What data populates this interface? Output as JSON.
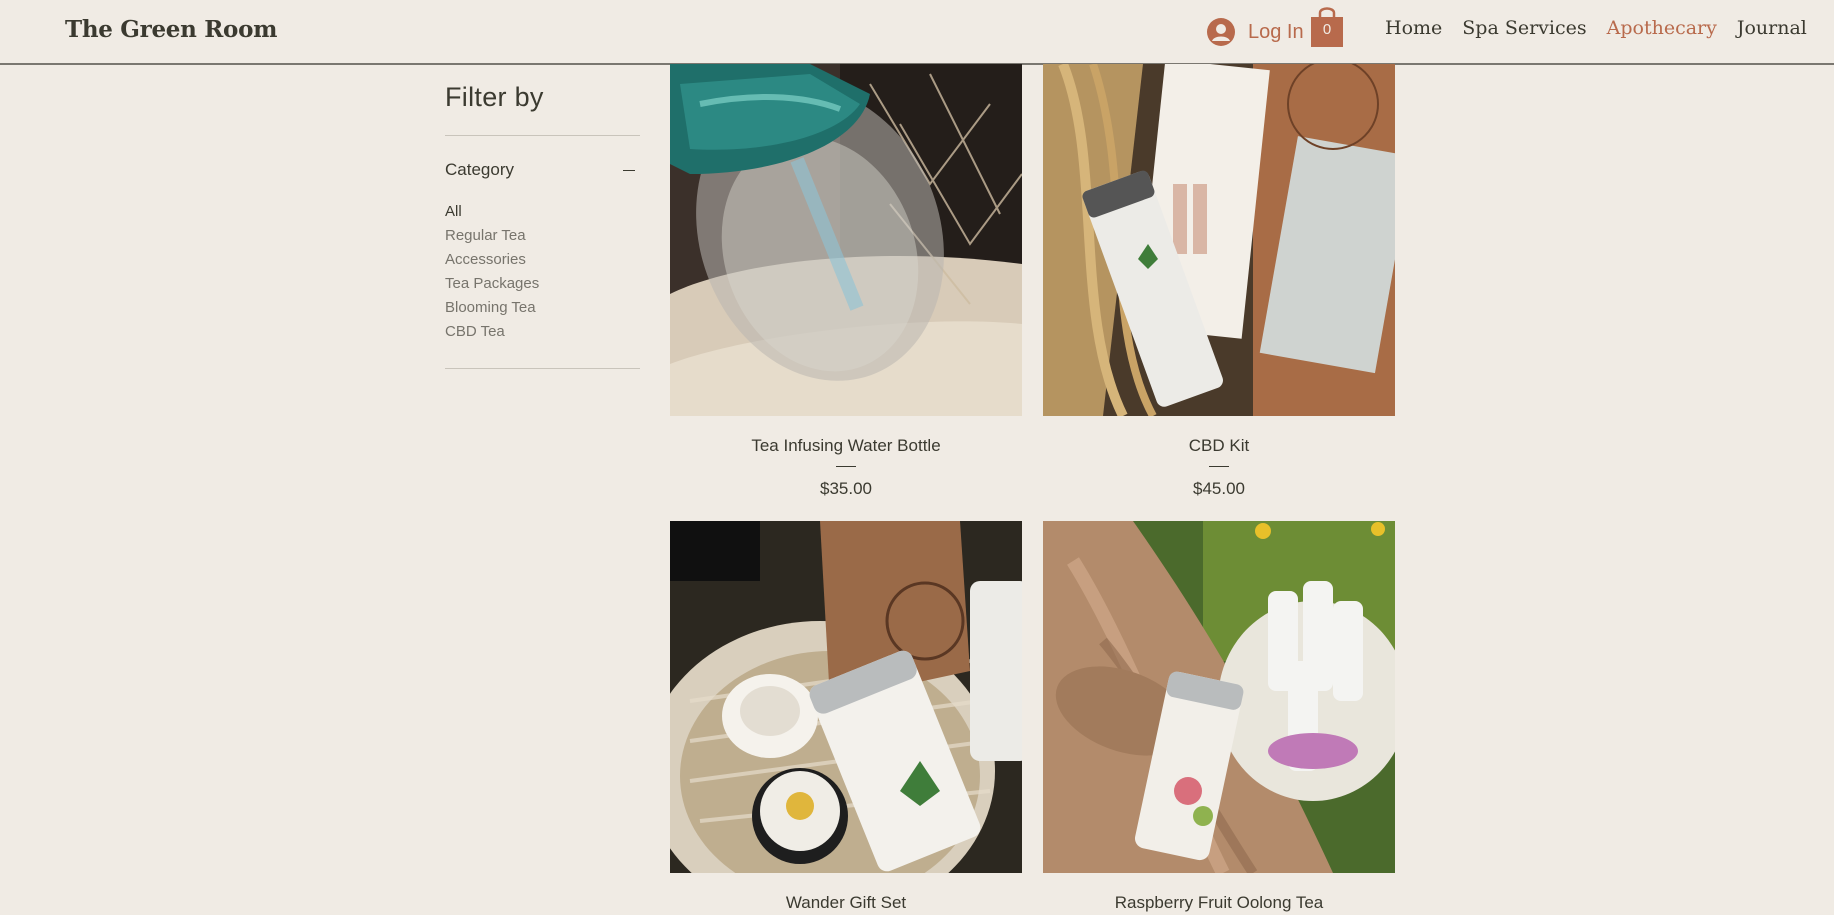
{
  "header": {
    "brand": "The Green Room",
    "login_label": "Log In",
    "cart_count": "0",
    "nav": [
      {
        "label": "Home",
        "active": false
      },
      {
        "label": "Spa Services",
        "active": false
      },
      {
        "label": "Apothecary",
        "active": true
      },
      {
        "label": "Journal",
        "active": false
      }
    ]
  },
  "filter": {
    "title": "Filter by",
    "category_label": "Category",
    "categories": [
      "All",
      "Regular Tea",
      "Accessories",
      "Tea Packages",
      "Blooming Tea",
      "CBD Tea"
    ],
    "selected": "All"
  },
  "products": [
    {
      "name": "Tea Infusing Water Bottle",
      "price": "$35.00",
      "image": "water-bottle-photo"
    },
    {
      "name": "CBD Kit",
      "price": "$45.00",
      "image": "cbd-kit-photo"
    },
    {
      "name": "Wander Gift Set",
      "price": "",
      "image": "gift-basket-photo"
    },
    {
      "name": "Raspberry Fruit Oolong Tea",
      "price": "",
      "image": "oolong-tin-photo"
    }
  ],
  "colors": {
    "background": "#f0ebe4",
    "accent": "#b86a4c",
    "text": "#3b3a30"
  }
}
